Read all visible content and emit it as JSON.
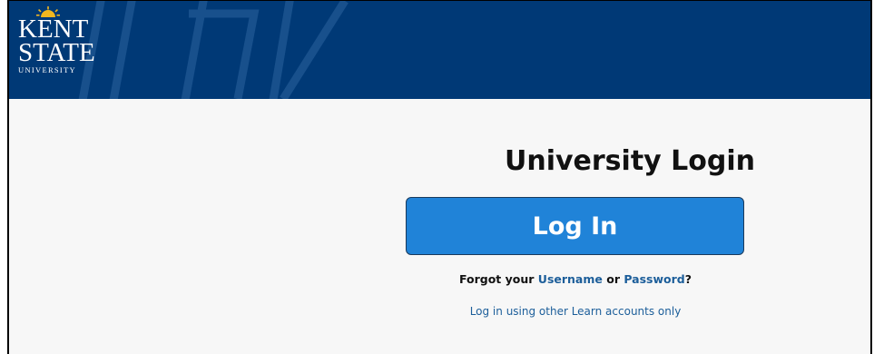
{
  "header": {
    "logo": {
      "line1": "KENT",
      "line2": "STATE",
      "line3": "UNIVERSITY"
    }
  },
  "main": {
    "title": "University Login",
    "login_button": "Log In",
    "forgot": {
      "prefix": "Forgot your ",
      "username_link": "Username",
      "middle": " or ",
      "password_link": "Password",
      "suffix": "?"
    },
    "other_accounts_link": "Log in using other Learn accounts only"
  },
  "colors": {
    "header_bg": "#003976",
    "button_bg": "#2083d8",
    "link": "#1c5e9a",
    "logo_sun": "#f2b71f"
  },
  "icons": {
    "logo_sun": "kent-state-sun-icon"
  }
}
